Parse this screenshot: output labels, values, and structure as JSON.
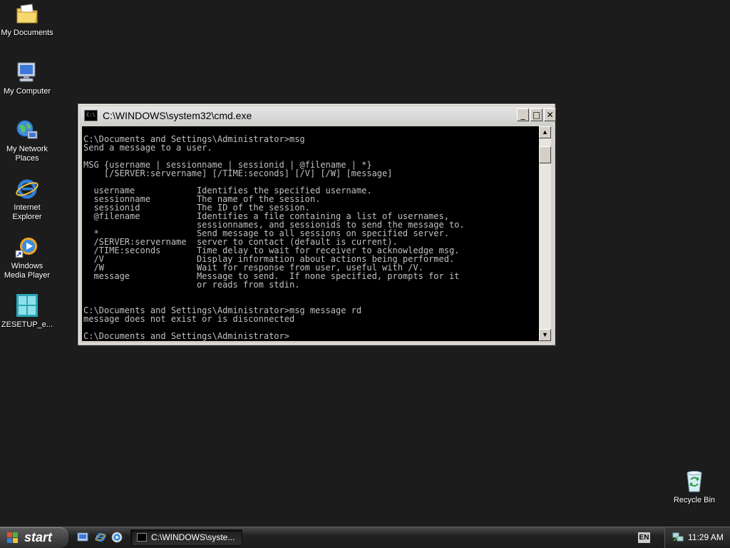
{
  "desktop": {
    "icons": [
      {
        "label": "My Documents"
      },
      {
        "label": "My Computer"
      },
      {
        "label": "My Network Places"
      },
      {
        "label": "Internet Explorer"
      },
      {
        "label": "Windows Media Player"
      },
      {
        "label": "ZESETUP_e..."
      },
      {
        "label": "Recycle Bin"
      }
    ]
  },
  "window": {
    "title": "C:\\WINDOWS\\system32\\cmd.exe",
    "minimize": "_",
    "maximize": "□",
    "close": "✕",
    "console_lines": [
      "C:\\Documents and Settings\\Administrator>msg",
      "Send a message to a user.",
      "",
      "MSG {username | sessionname | sessionid | @filename | *}",
      "    [/SERVER:servername] [/TIME:seconds] [/V] [/W] [message]",
      "",
      "  username            Identifies the specified username.",
      "  sessionname         The name of the session.",
      "  sessionid           The ID of the session.",
      "  @filename           Identifies a file containing a list of usernames,",
      "                      sessionnames, and sessionids to send the message to.",
      "  *                   Send message to all sessions on specified server.",
      "  /SERVER:servername  server to contact (default is current).",
      "  /TIME:seconds       Time delay to wait for receiver to acknowledge msg.",
      "  /V                  Display information about actions being performed.",
      "  /W                  Wait for response from user, useful with /V.",
      "  message             Message to send.  If none specified, prompts for it",
      "                      or reads from stdin.",
      "",
      "",
      "C:\\Documents and Settings\\Administrator>msg message rd",
      "message does not exist or is disconnected",
      "",
      "C:\\Documents and Settings\\Administrator>"
    ],
    "scroll_up": "▲",
    "scroll_down": "▼"
  },
  "taskbar": {
    "start_label": "start",
    "task_button_label": "C:\\WINDOWS\\syste...",
    "language": "EN",
    "clock": "11:29 AM"
  }
}
